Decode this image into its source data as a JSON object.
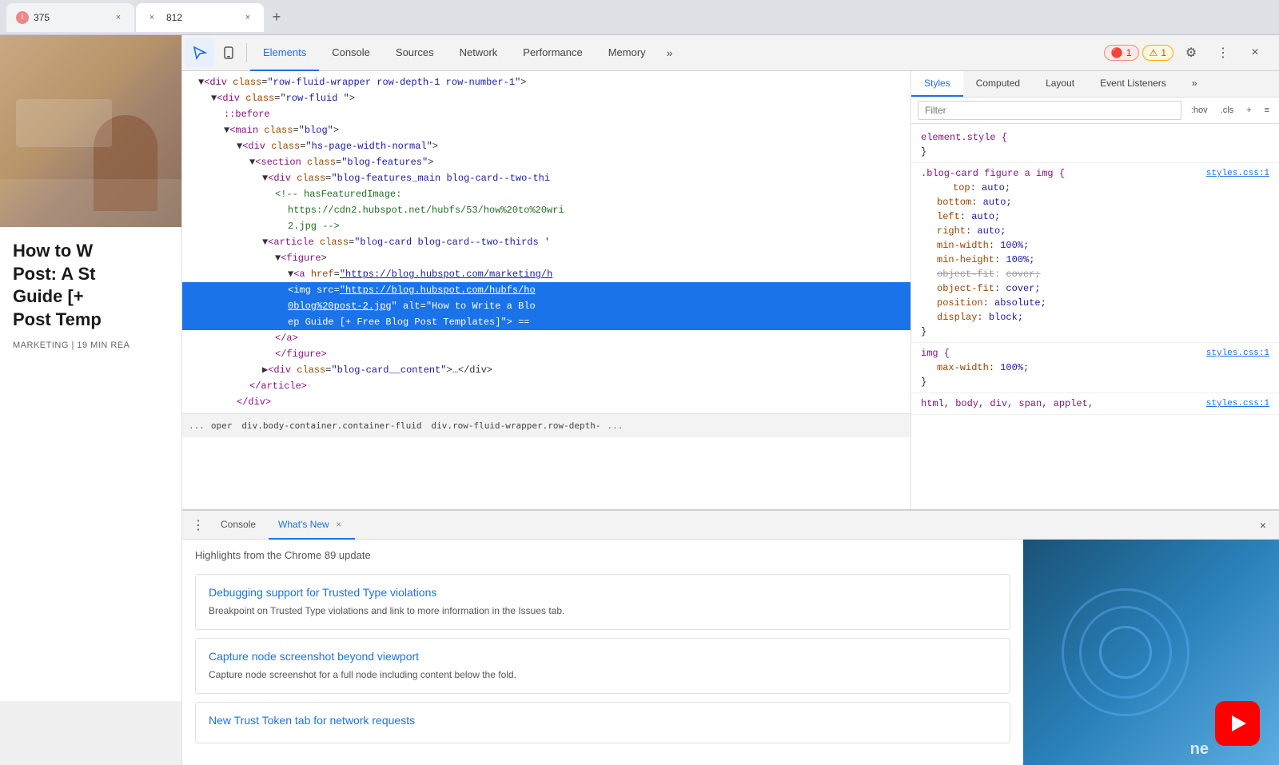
{
  "browser": {
    "tabs": [
      {
        "id": 1,
        "favicon": "i",
        "title": "375",
        "close": "×",
        "active": false
      },
      {
        "id": 2,
        "favicon": "×",
        "title": "812",
        "close": "×",
        "active": true
      }
    ]
  },
  "devtools": {
    "toolbar": {
      "inspect_label": "Inspect",
      "device_label": "Device",
      "tabs": [
        "Elements",
        "Console",
        "Sources",
        "Network",
        "Performance",
        "Memory",
        "»"
      ],
      "errors": "1",
      "warnings": "1",
      "error_icon": "🔴",
      "warn_icon": "⚠"
    },
    "styles_panel": {
      "tabs": [
        "Styles",
        "Computed",
        "Layout",
        "Event Listeners",
        "»"
      ],
      "filter_placeholder": "Filter",
      "hov_label": ":hov",
      "cls_label": ".cls",
      "rules": [
        {
          "selector": "element.style {",
          "close": "}",
          "props": [],
          "source": ""
        },
        {
          "selector": ".blog-card figure a img {",
          "close": "}",
          "source": "styles.css:1",
          "props": [
            {
              "name": "top",
              "value": "auto;",
              "strikethrough": false
            },
            {
              "name": "bottom",
              "value": "auto;",
              "strikethrough": false
            },
            {
              "name": "left",
              "value": "auto;",
              "strikethrough": false
            },
            {
              "name": "right",
              "value": "auto;",
              "strikethrough": false
            },
            {
              "name": "min-width",
              "value": "100%;",
              "strikethrough": false
            },
            {
              "name": "min-height",
              "value": "100%;",
              "strikethrough": false
            },
            {
              "name": "object-fit",
              "value": "cover;",
              "strikethrough": true
            },
            {
              "name": "object-fit",
              "value": "cover;",
              "strikethrough": false
            },
            {
              "name": "position",
              "value": "absolute;",
              "strikethrough": false
            },
            {
              "name": "display",
              "value": "block;",
              "strikethrough": false
            }
          ]
        },
        {
          "selector": "img {",
          "close": "}",
          "source": "styles.css:1",
          "props": [
            {
              "name": "max-width",
              "value": "100%;",
              "strikethrough": false
            }
          ]
        },
        {
          "selector": "html, body, div, span, applet,",
          "close": "",
          "source": "styles.css:1",
          "props": []
        }
      ]
    },
    "dom": {
      "lines": [
        {
          "indent": 1,
          "html": "▼<span class='tag-name'>&lt;div</span> <span class='attr-name'>class</span><span class='attr-equals'>=</span><span class='attr-value'>\"row-fluid-wrapper row-depth-1 row-number-1\"</span><span class='punctuation'>&gt;</span>",
          "selected": false
        },
        {
          "indent": 2,
          "html": "▼<span class='tag-name'>&lt;div</span> <span class='attr-name'>class</span><span class='attr-equals'>=</span><span class='attr-value'>\"row-fluid \"</span><span class='punctuation'>&gt;</span>",
          "selected": false
        },
        {
          "indent": 3,
          "html": "<span class='pseudo'>::before</span>",
          "selected": false
        },
        {
          "indent": 3,
          "html": "▼<span class='tag-name'>&lt;main</span> <span class='attr-name'>class</span><span class='attr-equals'>=</span><span class='attr-value'>\"blog\"</span><span class='punctuation'>&gt;</span>",
          "selected": false
        },
        {
          "indent": 4,
          "html": "▼<span class='tag-name'>&lt;div</span> <span class='attr-name'>class</span><span class='attr-equals'>=</span><span class='attr-value'>\"hs-page-width-normal\"</span><span class='punctuation'>&gt;</span>",
          "selected": false
        },
        {
          "indent": 5,
          "html": "▼<span class='tag-name'>&lt;section</span> <span class='attr-name'>class</span><span class='attr-equals'>=</span><span class='attr-value'>\"blog-features\"</span><span class='punctuation'>&gt;</span>",
          "selected": false
        },
        {
          "indent": 6,
          "html": "▼<span class='tag-name'>&lt;div</span> <span class='attr-name'>class</span><span class='attr-equals'>=</span><span class='attr-value'>\"blog-features_main blog-card--two-thi</span><span class='punctuation'>\"</span>",
          "selected": false
        },
        {
          "indent": 7,
          "html": "<span class='comment'>&lt;!-- hasFeaturedImage:</span>",
          "selected": false
        },
        {
          "indent": 8,
          "html": "<span class='comment'>https://cdn2.hubspot.net/hubfs/53/how%20to%20wri</span>",
          "selected": false
        },
        {
          "indent": 8,
          "html": "<span class='comment'>2.jpg --&gt;</span>",
          "selected": false
        },
        {
          "indent": 6,
          "html": "▼<span class='tag-name'>&lt;article</span> <span class='attr-name'>class</span><span class='attr-equals'>=</span><span class='attr-value'>\"blog-card blog-card--two-thirds '</span>",
          "selected": false
        },
        {
          "indent": 7,
          "html": "▼<span class='tag-name'>&lt;figure</span><span class='punctuation'>&gt;</span>",
          "selected": false
        },
        {
          "indent": 8,
          "html": "▼<span class='tag-name'>&lt;a</span> <span class='attr-name'>href</span><span class='attr-equals'>=</span><span class='attr-value url-link'>\"https://blog.hubspot.com/marketing/h</span>",
          "selected": false
        },
        {
          "indent": 8,
          "html": "<span class='tag-name'>&lt;img</span> <span class='attr-name'>src</span><span class='attr-equals'>=</span><span class='attr-value url-link'>\"https://blog.hubspot.com/hubfs/ho</span>",
          "selected": true
        },
        {
          "indent": 8,
          "html": "<span class='attr-value url-link'>0blog%20post-2.jpg</span><span class='attr-name'>\" alt</span><span class='attr-equals'>=</span><span class='attr-value'>\"How to Write a Blo</span>",
          "selected": true
        },
        {
          "indent": 8,
          "html": "<span class='attr-value'>ep Guide [+ Free Blog Post Templates]</span><span class='attr-name'>\"</span><span class='punctuation'>&gt;</span> <span class='punctuation'>==</span>",
          "selected": true
        },
        {
          "indent": 7,
          "html": "<span class='tag-name'>&lt;/a&gt;</span>",
          "selected": false
        },
        {
          "indent": 7,
          "html": "<span class='tag-name'>&lt;/figure&gt;</span>",
          "selected": false
        },
        {
          "indent": 6,
          "html": "▶<span class='tag-name'>&lt;div</span> <span class='attr-name'>class</span><span class='attr-equals'>=</span><span class='attr-value'>\"blog-card__content\"</span><span class='punctuation'>&gt;…&lt;/div&gt;</span>",
          "selected": false
        },
        {
          "indent": 5,
          "html": "<span class='tag-name'>&lt;/article&gt;</span>",
          "selected": false
        },
        {
          "indent": 4,
          "html": "<span class='tag-name'>&lt;/div&gt;</span>",
          "selected": false
        }
      ]
    },
    "breadcrumb": {
      "items": [
        "...",
        "oper",
        "div.body-container.container-fluid",
        "div.row-fluid-wrapper.row-depth-",
        "..."
      ]
    },
    "bottom_drawer": {
      "menu_icon": "⋮",
      "tabs": [
        {
          "label": "Console",
          "active": false,
          "closeable": false
        },
        {
          "label": "What's New",
          "active": true,
          "closeable": true
        }
      ],
      "close_btn": "×",
      "whats_new": {
        "subtitle": "Highlights from the Chrome 89 update",
        "features": [
          {
            "title": "Debugging support for Trusted Type violations",
            "desc": "Breakpoint on Trusted Type violations and link to more information in the Issues tab."
          },
          {
            "title": "Capture node screenshot beyond viewport",
            "desc": "Capture node screenshot for a full node including content below the fold."
          },
          {
            "title": "New Trust Token tab for network requests",
            "desc": ""
          }
        ]
      }
    }
  },
  "page": {
    "blog_image_alt": "Blog post image",
    "title_line1": "How to W",
    "title_line2": "Post: A St",
    "title_line3": "Guide [+",
    "title_line4": "Post Temp",
    "meta": "MARKETING | 19 MIN REA"
  },
  "icons": {
    "inspect": "⬚",
    "device": "□",
    "more_tabs": "»",
    "settings": "⚙",
    "more_menu": "⋮",
    "close": "×",
    "error": "🔴",
    "warning": "⚠️",
    "add_style": "+",
    "toggle_filter": "≡"
  }
}
